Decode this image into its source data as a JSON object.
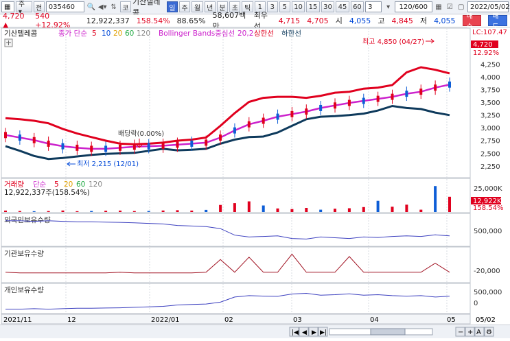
{
  "toolbar": {
    "period_1": "일",
    "period_2": "주",
    "stock_code": "035460",
    "jeon": "전",
    "ko_icon": "코",
    "stock_name": "기산텔레콤",
    "periods": [
      "일",
      "주",
      "월",
      "년",
      "분",
      "초",
      "틱"
    ],
    "intervals": [
      "1",
      "3",
      "5",
      "10",
      "15",
      "30",
      "45",
      "60"
    ],
    "interval_value": "3",
    "count": "120",
    "count_total": "600",
    "date": "2022/05/02"
  },
  "quote": {
    "price": "4,720",
    "change_arrow": "▲",
    "change": "540",
    "change_pct": "+12.92%",
    "volume": "12,922,337",
    "volume_ratio": "158.54%",
    "turnover": "88.65%",
    "amount": "58,607백만",
    "best_ask_label": "최우선",
    "best_ask": "4,715",
    "best_bid": "4,705",
    "open_label": "시",
    "open": "4,055",
    "high_label": "고",
    "high": "4,845",
    "low_label": "저",
    "low": "4,055",
    "buy_label": "매수",
    "sell_label": "매도"
  },
  "price_panel": {
    "legend": {
      "name": "기산텔레콤",
      "ma_label": "종가 단순",
      "ma5": "5",
      "ma10": "10",
      "ma20": "20",
      "ma60": "60",
      "ma120": "120",
      "bb_label": "Bollinger Bands중심선",
      "bb_period": "20,2",
      "bb_upper": "상한선",
      "bb_lower": "하한선"
    },
    "lc_label": "LC:107.47",
    "axis_ticks": [
      "4,250",
      "4,000",
      "3,750",
      "3,500",
      "3,250",
      "3,000",
      "2,750",
      "2,500",
      "2,250"
    ],
    "last_price_tag": "4,720",
    "last_pct_tag": "12.92%",
    "high_annotation": "최고 4,850 (04/27)",
    "low_annotation": "최저 2,215 (12/01)",
    "dividend_annotation": "배당락(0.00%)"
  },
  "volume_panel": {
    "legend": {
      "name": "거래량",
      "ma_label": "단순",
      "ma5": "5",
      "ma20": "20",
      "ma60": "60",
      "ma120": "120"
    },
    "volume_text": "12,922,337주(158.54%)",
    "axis_tick": "25,000K",
    "last_tag": "12,922K",
    "last_pct_tag": "158.54%"
  },
  "foreign_panel": {
    "title": "외국인보유수량",
    "axis_tick": "500,000"
  },
  "inst_panel": {
    "title": "기관보유수량",
    "axis_tick": "-20,000"
  },
  "indiv_panel": {
    "title": "개인보유수량",
    "axis_tick_1": "500,000",
    "axis_tick_2": "0"
  },
  "x_axis": {
    "labels": [
      "2021/11",
      "12",
      "2022/01",
      "02",
      "03",
      "04",
      "05"
    ],
    "right_label": "05/02"
  },
  "colors": {
    "up": "#e0001e",
    "down": "#0d5dd6",
    "bb_upper": "#e0001e",
    "bb_lower": "#0e3a5c",
    "bb_mid": "#cc22cc",
    "ma60": "#22aa44",
    "ma120": "#8a8a8a"
  },
  "chart_data": [
    {
      "type": "line",
      "title": "기산텔레콤 일봉",
      "series": [
        {
          "name": "Bollinger 상한선",
          "values": [
            3200,
            3180,
            3150,
            3100,
            2990,
            2900,
            2830,
            2760,
            2700,
            2690,
            2700,
            2720,
            2760,
            2780,
            2820,
            3050,
            3300,
            3520,
            3600,
            3620,
            3620,
            3600,
            3640,
            3700,
            3720,
            3780,
            3800,
            3850,
            4100,
            4200,
            4150,
            4080
          ]
        },
        {
          "name": "Bollinger 하한선",
          "values": [
            2650,
            2560,
            2460,
            2400,
            2420,
            2450,
            2480,
            2500,
            2510,
            2520,
            2560,
            2600,
            2570,
            2580,
            2600,
            2700,
            2780,
            2830,
            2840,
            2920,
            3050,
            3180,
            3230,
            3240,
            3260,
            3290,
            3350,
            3440,
            3400,
            3380,
            3310,
            3260
          ]
        },
        {
          "name": "Bollinger 중심선",
          "values": [
            2870,
            2820,
            2770,
            2700,
            2650,
            2620,
            2600,
            2600,
            2620,
            2640,
            2650,
            2660,
            2680,
            2700,
            2720,
            2820,
            2960,
            3080,
            3150,
            3230,
            3280,
            3330,
            3400,
            3450,
            3500,
            3540,
            3580,
            3620,
            3680,
            3720,
            3800,
            3860
          ]
        }
      ]
    },
    {
      "type": "bar",
      "title": "거래량",
      "values": [
        1200,
        900,
        700,
        800,
        1300,
        700,
        900,
        1100,
        1200,
        800,
        900,
        1300,
        1500,
        1200,
        1800,
        6000,
        7500,
        9000,
        5500,
        3000,
        2500,
        3500,
        2000,
        2800,
        3200,
        4200,
        9500,
        4500,
        6200,
        2000,
        22000,
        12922
      ]
    }
  ]
}
